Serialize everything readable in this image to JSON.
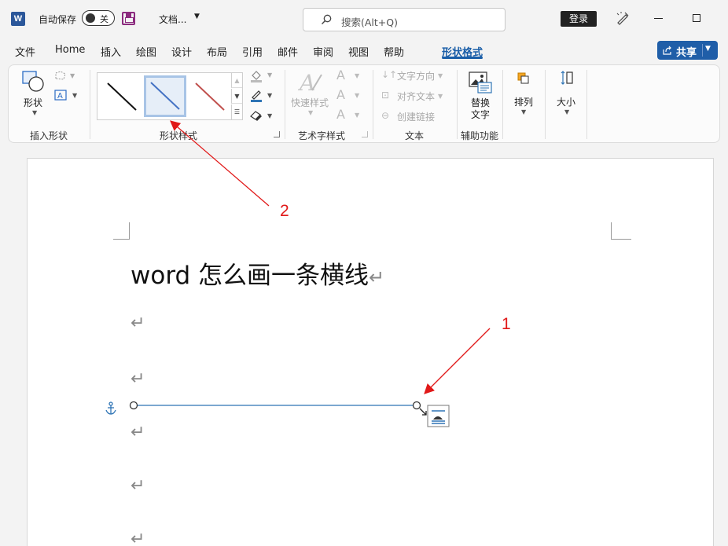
{
  "titlebar": {
    "autosave_label": "自动保存",
    "autosave_state": "关",
    "document_name": "文档...",
    "search_placeholder": "搜索(Alt+Q)",
    "login_label": "登录",
    "app_logo": "W"
  },
  "tabs": [
    "文件",
    "Home",
    "插入",
    "绘图",
    "设计",
    "布局",
    "引用",
    "邮件",
    "审阅",
    "视图",
    "帮助",
    "形状格式"
  ],
  "active_tab": "形状格式",
  "share_label": "共享",
  "ribbon": {
    "insert_shapes": {
      "shapes_label": "形状",
      "group_label": "插入形状"
    },
    "shape_styles": {
      "group_label": "形状样式",
      "selected_index": 1,
      "styles": [
        {
          "color": "#111111"
        },
        {
          "color": "#4472c4"
        },
        {
          "color": "#c0504d"
        }
      ]
    },
    "wordart_styles": {
      "quick_styles_label": "快速样式",
      "group_label": "艺术字样式"
    },
    "text": {
      "text_direction_label": "文字方向",
      "align_text_label": "对齐文本",
      "create_link_label": "创建链接",
      "group_label": "文本"
    },
    "accessibility": {
      "alt_text_label_1": "替换",
      "alt_text_label_2": "文字",
      "group_label": "辅助功能"
    },
    "arrange_label": "排列",
    "size_label": "大小"
  },
  "document": {
    "title": "word 怎么画一条横线",
    "paragraph_mark": "↵",
    "line_color": "#2e74b5"
  },
  "annotations": {
    "one": "1",
    "two": "2",
    "color": "#e11919"
  }
}
